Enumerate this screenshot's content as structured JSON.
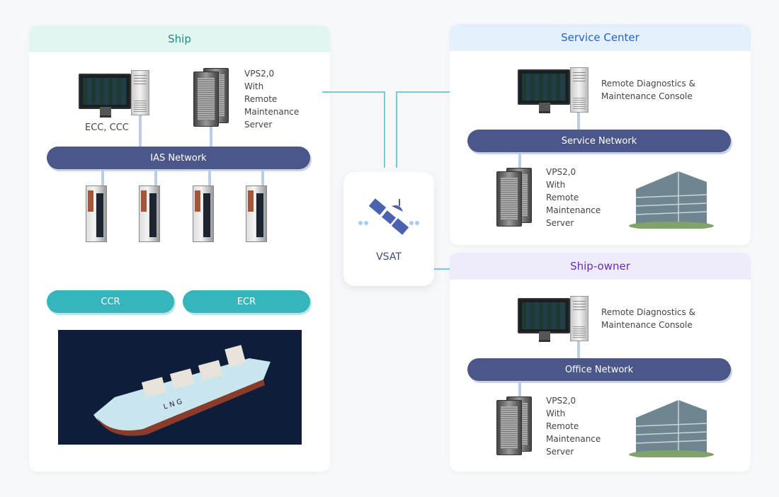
{
  "ship": {
    "title": "Ship",
    "console_label": "ECC, CCC",
    "server_label": [
      "VPS2,0",
      "With",
      "Remote",
      "Maintenance",
      "Server"
    ],
    "network": "IAS Network",
    "rooms": [
      "CCR",
      "ECR"
    ],
    "ship_image_text": "L N G"
  },
  "vsat": {
    "label": "VSAT",
    "icon": "satellite-icon"
  },
  "service_center": {
    "title": "Service Center",
    "console_label": [
      "Remote Diagnostics &",
      "Maintenance Console"
    ],
    "network": "Service Network",
    "server_label": [
      "VPS2,0",
      "With",
      "Remote",
      "Maintenance",
      "Server"
    ]
  },
  "ship_owner": {
    "title": "Ship-owner",
    "console_label": [
      "Remote Diagnostics &",
      "Maintenance Console"
    ],
    "network": "Office Network",
    "server_label": [
      "VPS2,0",
      "With",
      "Remote",
      "Maintenance",
      "Server"
    ]
  },
  "colors": {
    "network": "#4a5788",
    "room": "#36b5bd",
    "arrow": "#6fcfd6",
    "ship_head": "#1f8a80",
    "service_head": "#2563c9",
    "owner_head": "#6a2bb0"
  }
}
